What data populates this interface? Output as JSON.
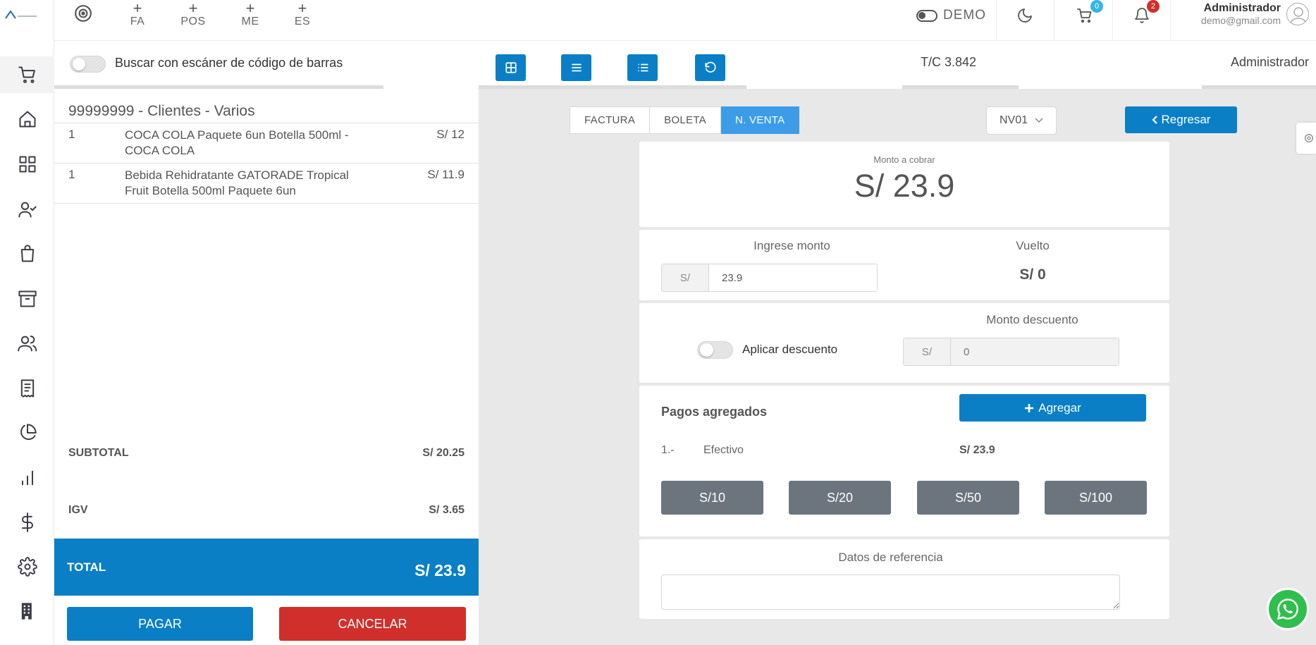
{
  "header": {
    "quick_links": [
      "FA",
      "POS",
      "ME",
      "ES"
    ],
    "demo_label": "DEMO",
    "cart_count": "0",
    "notif_count": "2",
    "user_name": "Administrador",
    "user_email": "demo@gmail.com"
  },
  "toolbar": {
    "scan_label": "Buscar con escáner de código de barras",
    "exchange_rate": "T/C 3.842",
    "user_label": "Administrador"
  },
  "order": {
    "client": "99999999 - Clientes - Varios",
    "items": [
      {
        "qty": "1",
        "desc": "COCA COLA Paquete 6un Botella 500ml - COCA COLA",
        "price": "S/ 12"
      },
      {
        "qty": "1",
        "desc": "Bebida Rehidratante GATORADE Tropical Fruit Botella 500ml Paquete 6un",
        "price": "S/ 11.9"
      }
    ],
    "subtotal_label": "SUBTOTAL",
    "subtotal": "S/ 20.25",
    "igv_label": "IGV",
    "igv": "S/ 3.65",
    "total_label": "TOTAL",
    "total": "S/ 23.9",
    "pay_label": "PAGAR",
    "cancel_label": "CANCELAR"
  },
  "payment": {
    "doc_types": [
      "FACTURA",
      "BOLETA",
      "N. VENTA"
    ],
    "active_doc": "N. VENTA",
    "series": "NV01",
    "back_label": "Regresar",
    "amount_label": "Monto a cobrar",
    "amount": "S/ 23.9",
    "enter_label": "Ingrese monto",
    "currency_prefix": "S/",
    "entered_amount": "23.9",
    "change_label": "Vuelto",
    "change": "S/ 0",
    "discount_toggle_label": "Aplicar descuento",
    "discount_label": "Monto descuento",
    "discount_placeholder": "0",
    "payments_title": "Pagos agregados",
    "add_label": "Agregar",
    "payments": [
      {
        "index": "1.-",
        "method": "Efectivo",
        "amount": "S/ 23.9"
      }
    ],
    "quick_amounts": [
      "S/10",
      "S/20",
      "S/50",
      "S/100"
    ],
    "reference_label": "Datos de referencia"
  },
  "colors": {
    "primary": "#0a7fc6",
    "danger": "#d12f2b",
    "active_tab": "#3d9ce8",
    "secondary": "#6c757d"
  }
}
